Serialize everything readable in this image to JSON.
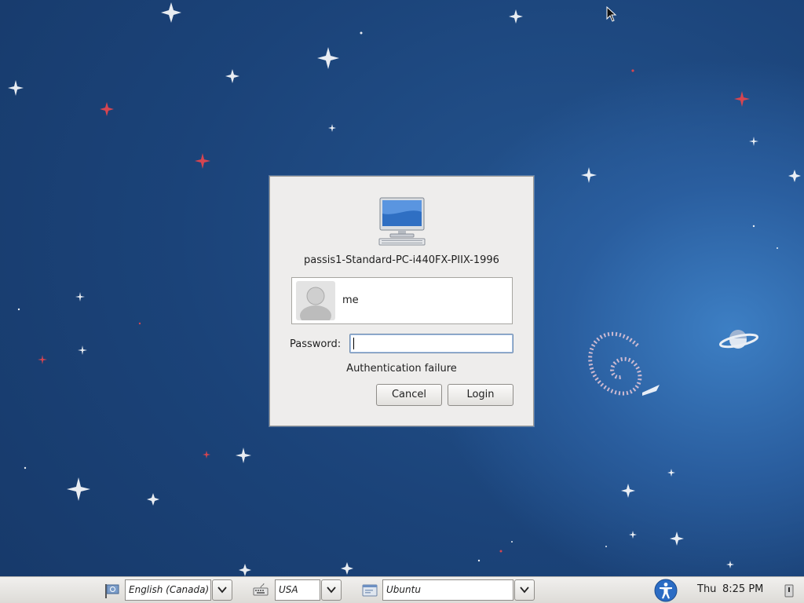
{
  "login": {
    "hostname": "passis1-Standard-PC-i440FX-PIIX-1996",
    "username": "me",
    "password_label": "Password:",
    "password_value": "",
    "message": "Authentication failure",
    "cancel_label": "Cancel",
    "login_label": "Login"
  },
  "panel": {
    "language": "English (Canada)",
    "keyboard_layout": "USA",
    "session": "Ubuntu",
    "day": "Thu",
    "time": "8:25 PM"
  },
  "icons": {
    "computer": "computer-icon",
    "avatar": "user-avatar-icon",
    "language": "language-flag-icon",
    "keyboard": "keyboard-icon",
    "session": "session-icon",
    "accessibility": "accessibility-icon",
    "shutdown": "shutdown-icon"
  },
  "colors": {
    "desktop_background": "#1b4379",
    "accessibility_blue": "#2b6cc4"
  }
}
